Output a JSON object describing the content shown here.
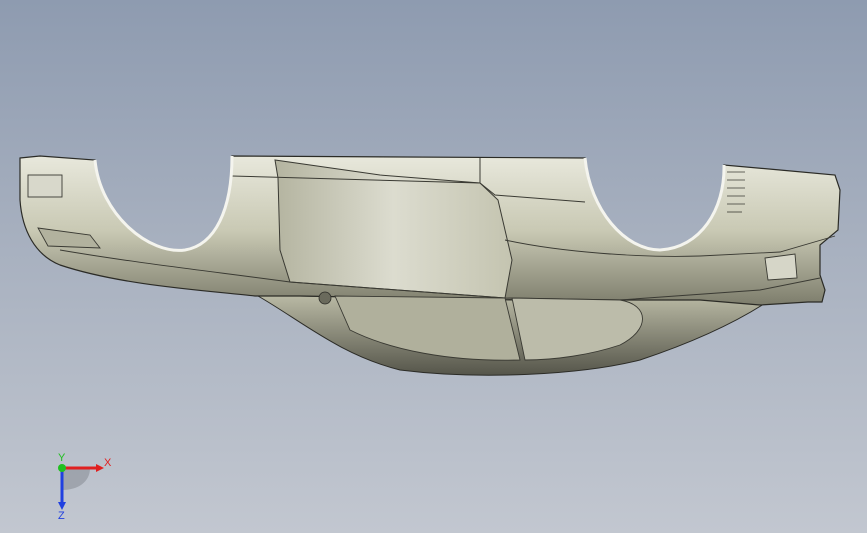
{
  "viewport": {
    "background_top": "#8e9bb0",
    "background_bottom": "#c2c7d0",
    "model_color": "#c9c9b4",
    "model_edge_color": "#2b2b26"
  },
  "triad": {
    "x_label": "X",
    "y_label": "Y",
    "z_label": "Z",
    "x_color": "#e02020",
    "y_color": "#20c020",
    "z_color": "#2040e0"
  }
}
